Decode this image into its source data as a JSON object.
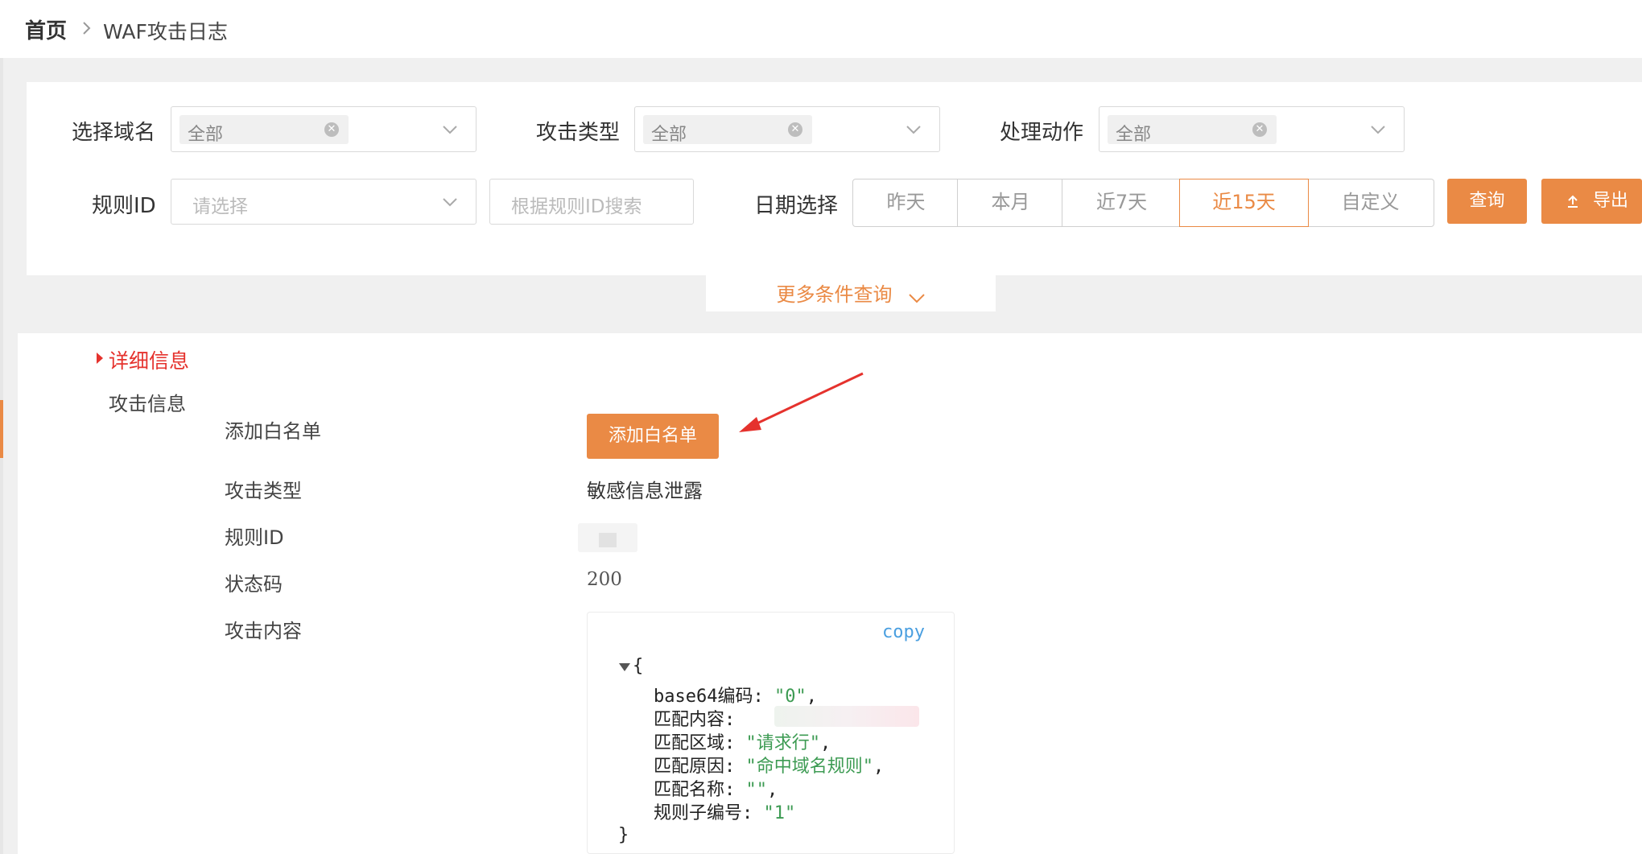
{
  "breadcrumb": {
    "home": "首页",
    "current": "WAF攻击日志"
  },
  "filters": {
    "domain": {
      "label": "选择域名",
      "tag": "全部"
    },
    "attack_type": {
      "label": "攻击类型",
      "tag": "全部"
    },
    "action": {
      "label": "处理动作",
      "tag": "全部"
    },
    "rule_id": {
      "label": "规则ID",
      "placeholder": "请选择",
      "search_placeholder": "根据规则ID搜索"
    },
    "date": {
      "label": "日期选择",
      "options": [
        "昨天",
        "本月",
        "近7天",
        "近15天",
        "自定义"
      ],
      "selected": "近15天"
    },
    "query_button": "查询",
    "export_button": "导出",
    "more_conditions": "更多条件查询"
  },
  "detail": {
    "section_title": "详细信息",
    "group_title": "攻击信息",
    "rows": {
      "whitelist_label": "添加白名单",
      "whitelist_button": "添加白名单",
      "attack_type_label": "攻击类型",
      "attack_type_value": "敏感信息泄露",
      "rule_id_label": "规则ID",
      "status_label": "状态码",
      "status_value": "200",
      "content_label": "攻击内容"
    },
    "code": {
      "copy": "copy",
      "open": "{",
      "close": "}",
      "fields": [
        {
          "key": "base64编码",
          "value": "\"0\""
        },
        {
          "key": "匹配内容",
          "value": ""
        },
        {
          "key": "匹配区域",
          "value": "\"请求行\""
        },
        {
          "key": "匹配原因",
          "value": "\"命中域名规则\""
        },
        {
          "key": "匹配名称",
          "value": "\"\""
        },
        {
          "key": "规则子编号",
          "value": "\"1\""
        }
      ]
    }
  },
  "colors": {
    "accent": "#ea8a45",
    "section_red": "#e5322d",
    "string_green": "#3d9b53",
    "copy_blue": "#4a9fe0"
  }
}
